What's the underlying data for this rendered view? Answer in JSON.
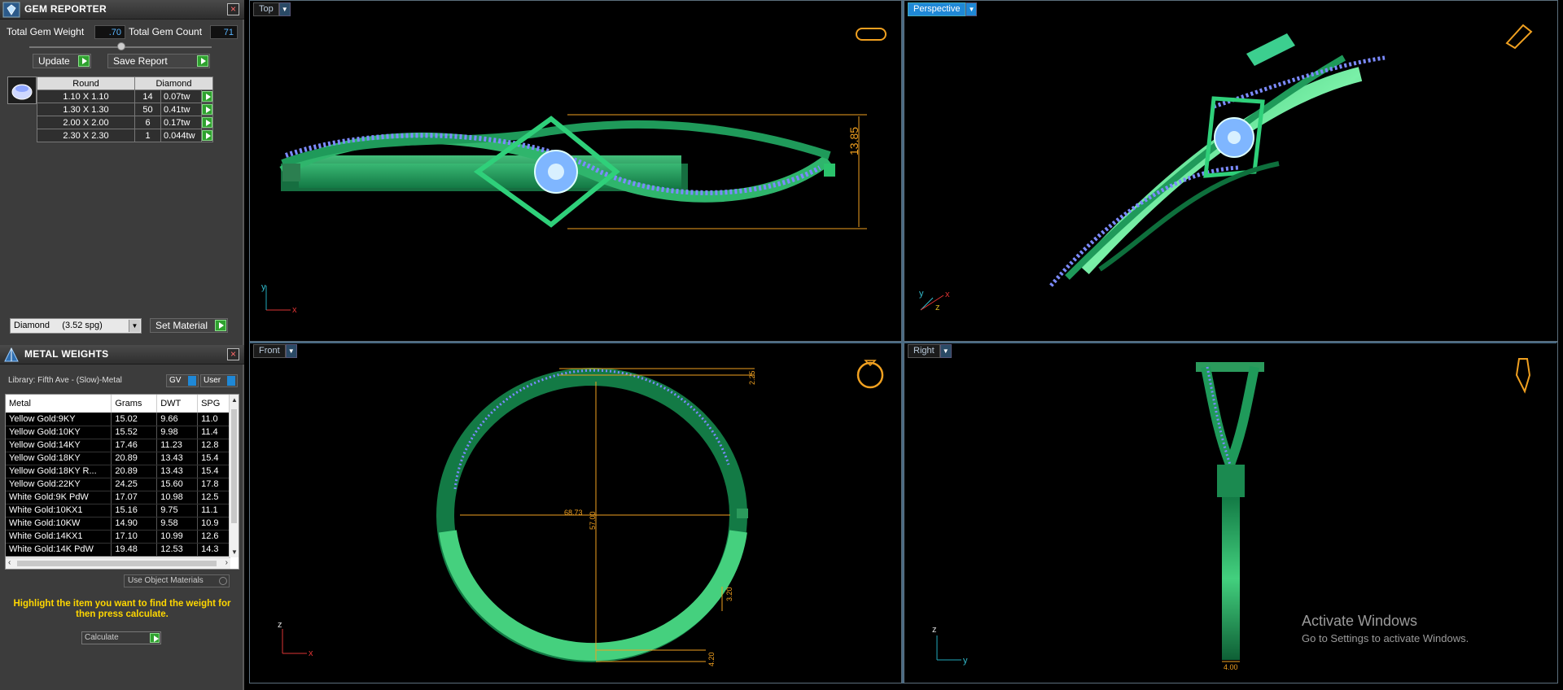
{
  "gem_reporter": {
    "title": "GEM REPORTER",
    "close": "×",
    "total_weight_label": "Total Gem Weight",
    "total_weight_value": ".70",
    "total_count_label": "Total Gem Count",
    "total_count_value": "71",
    "update_label": "Update",
    "save_label": "Save Report",
    "table_shape": "Round",
    "table_type": "Diamond",
    "rows": [
      {
        "size": "1.10 X 1.10",
        "count": "14",
        "weight": "0.07tw"
      },
      {
        "size": "1.30 X 1.30",
        "count": "50",
        "weight": "0.41tw"
      },
      {
        "size": "2.00 X 2.00",
        "count": "6",
        "weight": "0.17tw"
      },
      {
        "size": "2.30 X 2.30",
        "count": "1",
        "weight": "0.044tw"
      }
    ],
    "material_select": "Diamond     (3.52 spg)",
    "set_material_label": "Set Material"
  },
  "metal_weights": {
    "title": "METAL WEIGHTS",
    "close": "×",
    "library": "Library: Fifth Ave - (Slow)-Metal",
    "gv_label": "GV",
    "user_label": "User",
    "columns": [
      "Metal",
      "Grams",
      "DWT",
      "SPG"
    ],
    "rows": [
      [
        "Yellow Gold:9KY",
        "15.02",
        "9.66",
        "11.0"
      ],
      [
        "Yellow Gold:10KY",
        "15.52",
        "9.98",
        "11.4"
      ],
      [
        "Yellow Gold:14KY",
        "17.46",
        "11.23",
        "12.8"
      ],
      [
        "Yellow Gold:18KY",
        "20.89",
        "13.43",
        "15.4"
      ],
      [
        "Yellow Gold:18KY R...",
        "20.89",
        "13.43",
        "15.4"
      ],
      [
        "Yellow Gold:22KY",
        "24.25",
        "15.60",
        "17.8"
      ],
      [
        "White Gold:9K PdW",
        "17.07",
        "10.98",
        "12.5"
      ],
      [
        "White Gold:10KX1",
        "15.16",
        "9.75",
        "11.1"
      ],
      [
        "White Gold:10KW",
        "14.90",
        "9.58",
        "10.9"
      ],
      [
        "White Gold:14KX1",
        "17.10",
        "10.99",
        "12.6"
      ],
      [
        "White Gold:14K PdW",
        "19.48",
        "12.53",
        "14.3"
      ]
    ],
    "use_object_materials": "Use Object Materials",
    "hint": "Highlight the item you want to find the weight for then press calculate.",
    "calculate_label": "Calculate"
  },
  "viewports": {
    "top": {
      "label": "Top",
      "dimension": "13.85"
    },
    "perspective": {
      "label": "Perspective"
    },
    "front": {
      "label": "Front",
      "dim_width": "68.73",
      "dim_height": "57.00",
      "dim_side": "3.20",
      "dim_bottom": "4.20",
      "dim_top": "2.25"
    },
    "right": {
      "label": "Right",
      "dim_bottom": "4.00"
    }
  },
  "watermark": {
    "line1": "Activate Windows",
    "line2": "Go to Settings to activate Windows."
  },
  "colors": {
    "metal": "#1f9a5a",
    "metal_light": "#3fd07e",
    "stones": "#7fa6ff",
    "dimension": "#f0a020",
    "accent": "#1f88d6"
  }
}
